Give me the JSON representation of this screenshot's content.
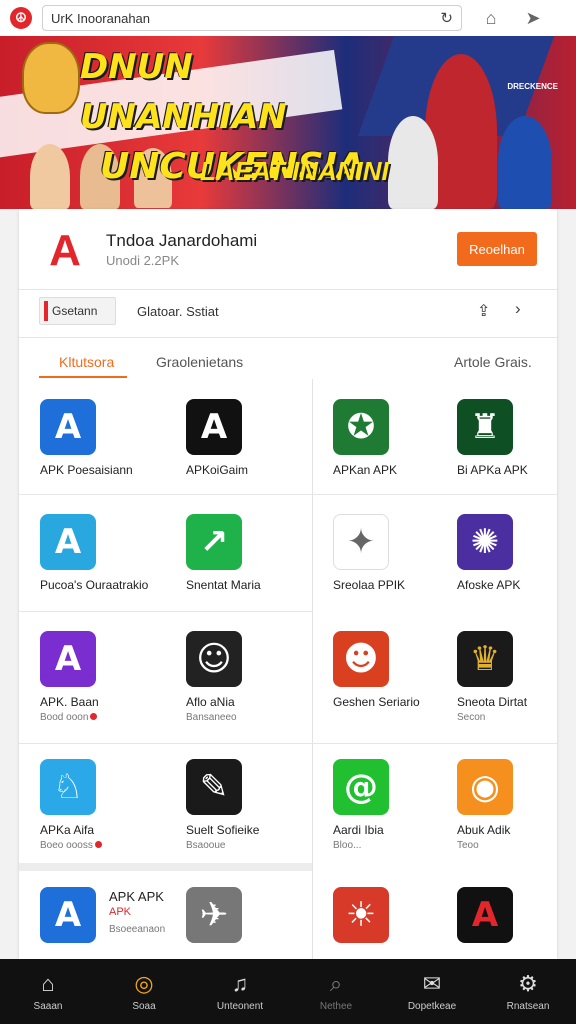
{
  "browser": {
    "url": "UrK Inooranahan",
    "reload_icon": "reload-icon",
    "home_icon": "home-icon",
    "send_icon": "send-icon"
  },
  "banner": {
    "title_line1": "DNUN UNANHIAN",
    "title_line2": "UNCUKENSIA",
    "subtitle": "LAEAT INANINI",
    "tag": "DRECKENCE"
  },
  "app": {
    "name": "Tndoa Janardohami",
    "subtitle": "Unodi 2.2PK",
    "install_label": "Reoelhan",
    "logo_letter": "A"
  },
  "chips": {
    "chip_label": "Gsetann",
    "filter_label": "Glatoar. Sstiat"
  },
  "tabs": [
    {
      "label": "Kltutsora",
      "active": true
    },
    {
      "label": "Graolenietans",
      "active": false
    },
    {
      "label": "Artole Grais.",
      "active": false
    }
  ],
  "apps": [
    {
      "label": "APK Poesaisiann",
      "meta": "",
      "letter": "A",
      "bg": "#1e6fd9"
    },
    {
      "label": "APKoiGaim",
      "meta": "",
      "letter": "A",
      "bg": "#111111"
    },
    {
      "label": "APKan APK",
      "meta": "",
      "letter": "✪",
      "bg": "#1f7a34"
    },
    {
      "label": "Bi APKa APK",
      "meta": "",
      "letter": "♜",
      "bg": "#0f4f24"
    },
    {
      "label": "Pucoa's Ouraatrakio",
      "meta": "",
      "letter": "A",
      "bg": "#29a8e0"
    },
    {
      "label": "Snentat Maria",
      "meta": "",
      "letter": "↗",
      "bg": "#1fb24a"
    },
    {
      "label": "Sreolaa PPIK",
      "meta": "",
      "letter": "✦",
      "bg": "#ffffff"
    },
    {
      "label": "Afoske APK",
      "meta": "",
      "letter": "✺",
      "bg": "#4b2ea0"
    },
    {
      "label": "APK. Baan",
      "meta": "Bood ooon",
      "letter": "A",
      "bg": "#7a2ed0"
    },
    {
      "label": "Aflo aNia",
      "meta": "Bansaneeo",
      "letter": "☺",
      "bg": "#222222"
    },
    {
      "label": "Geshen Seriario",
      "meta": "",
      "letter": "☻",
      "bg": "#d84020"
    },
    {
      "label": "Sneota Dirtat",
      "meta": "Secon",
      "letter": "♛",
      "bg": "#1a1a1a"
    },
    {
      "label": "APKa Aifa",
      "meta": "Boeo oooss",
      "letter": "♘",
      "bg": "#2aa8e8"
    },
    {
      "label": "Suelt Sofieike",
      "meta": "Bsaooue",
      "letter": "✎",
      "bg": "#1a1a1a"
    },
    {
      "label": "Aardi Ibia",
      "meta": "Bloo...",
      "letter": "@",
      "bg": "#20c030"
    },
    {
      "label": "Abuk Adik",
      "meta": "Teoo",
      "letter": "◉",
      "bg": "#f5901e"
    },
    {
      "label": "APK APK",
      "meta": "APK",
      "letter": "A",
      "bg": "#1e6fd9"
    },
    {
      "label": "",
      "meta": "",
      "letter": "✈",
      "bg": "#777777"
    },
    {
      "label": "",
      "meta": "",
      "letter": "☀",
      "bg": "#d83a2a"
    },
    {
      "label": "",
      "meta": "",
      "letter": "A",
      "bg": "#111111"
    }
  ],
  "featured_extra": {
    "title": "APK APK",
    "subtitle": "APK",
    "meta": "Bsoeeanaon"
  },
  "bottom_nav": [
    {
      "label": "Saaan",
      "icon": "home-icon",
      "glyph": "⌂",
      "state": "normal"
    },
    {
      "label": "Soaa",
      "icon": "games-icon",
      "glyph": "◎",
      "state": "active"
    },
    {
      "label": "Unteonent",
      "icon": "music-icon",
      "glyph": "♫",
      "state": "normal"
    },
    {
      "label": "Nethee",
      "icon": "search-icon",
      "glyph": "⌕",
      "state": "dim"
    },
    {
      "label": "Dopetkeae",
      "icon": "edit-icon",
      "glyph": "✉",
      "state": "normal"
    },
    {
      "label": "Rnatsean",
      "icon": "settings-icon",
      "glyph": "⚙",
      "state": "normal"
    }
  ]
}
